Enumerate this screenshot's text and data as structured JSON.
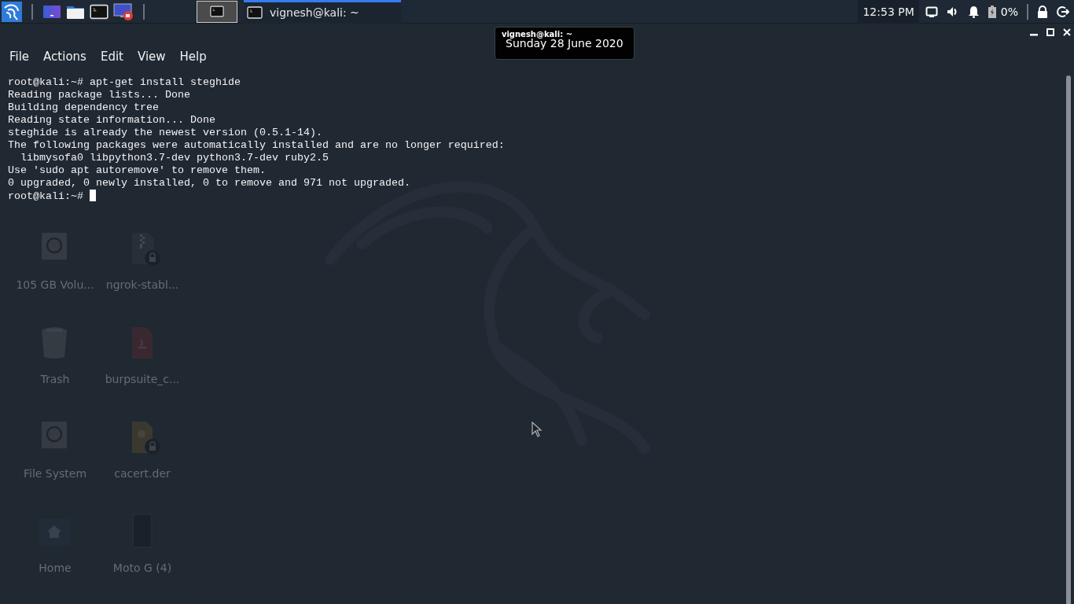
{
  "taskbar": {
    "workspaces": [
      {
        "selected": true
      }
    ],
    "tasks": [
      {
        "title": "vignesh@kali: ~",
        "selected": true
      }
    ],
    "clock": "12:53 PM",
    "battery": "0%"
  },
  "desktop_icons": [
    {
      "label": "105 GB Volu...",
      "kind": "drive",
      "locked": false
    },
    {
      "label": "ngrok-stabl...",
      "kind": "archive",
      "locked": true
    },
    {
      "label": "Trash",
      "kind": "trash",
      "locked": false
    },
    {
      "label": "burpsuite_c...",
      "kind": "java",
      "locked": false
    },
    {
      "label": "File System",
      "kind": "drive",
      "locked": false
    },
    {
      "label": "cacert.der",
      "kind": "certificate",
      "locked": true
    },
    {
      "label": "Home",
      "kind": "home",
      "locked": false
    },
    {
      "label": "Moto G (4)",
      "kind": "phone",
      "locked": false
    }
  ],
  "window": {
    "title": "vignesh@kali: ~",
    "menu": [
      "File",
      "Actions",
      "Edit",
      "View",
      "Help"
    ],
    "lines": [
      "root@kali:~# apt-get install steghide",
      "Reading package lists... Done",
      "Building dependency tree",
      "Reading state information... Done",
      "steghide is already the newest version (0.5.1-14).",
      "The following packages were automatically installed and are no longer required:",
      "  libmysofa0 libpython3.7-dev python3.7-dev ruby2.5",
      "Use 'sudo apt autoremove' to remove them.",
      "0 upgraded, 0 newly installed, 0 to remove and 971 not upgraded.",
      "root@kali:~# "
    ],
    "cursor": true
  },
  "tooltip": "Sunday 28 June 2020"
}
